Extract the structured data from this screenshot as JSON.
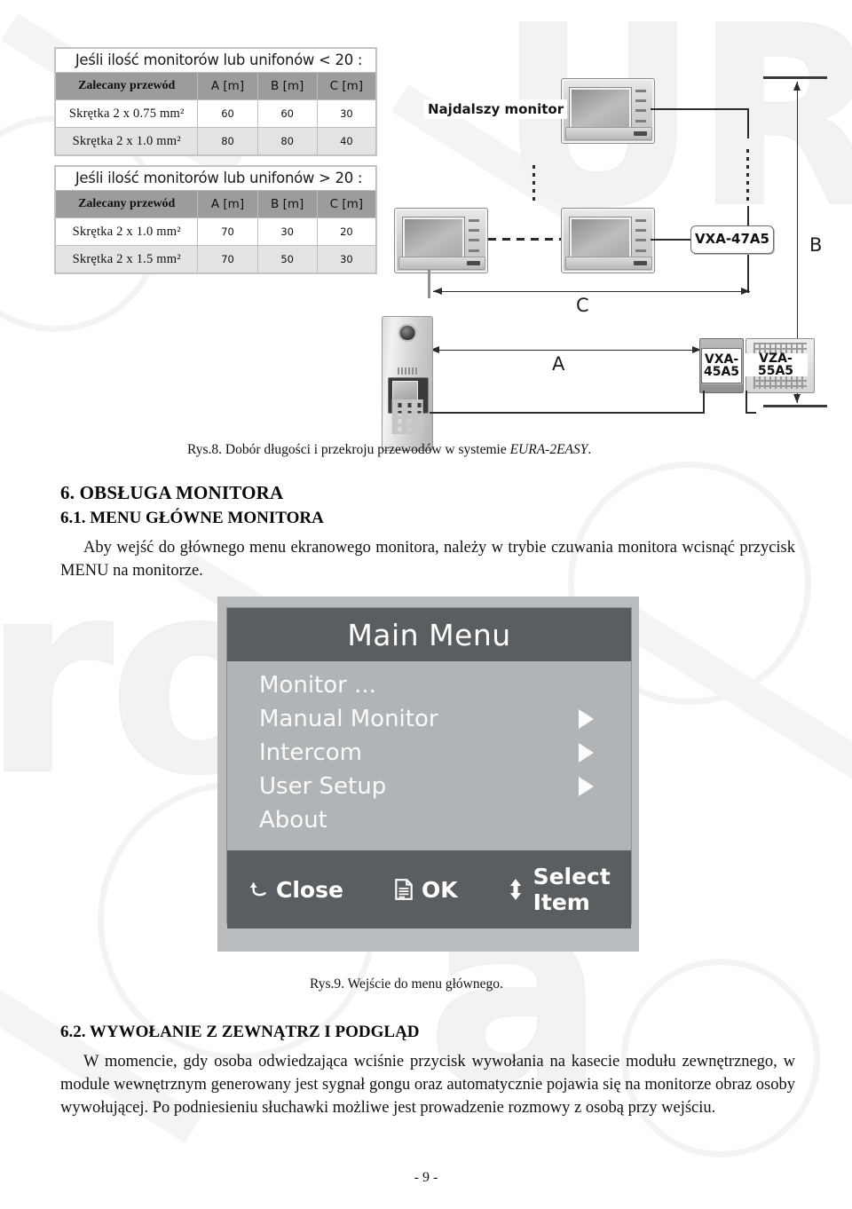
{
  "figure8": {
    "caption_prefix": "Rys.8. Dobór długości i przekroju przewodów w systemie ",
    "caption_italic": "EURA-2EASY",
    "caption_suffix": ".",
    "tables": [
      {
        "title": "Jeśli ilość monitorów lub unifonów < 20 :",
        "columns": [
          "Zalecany przewód",
          "A [m]",
          "B [m]",
          "C [m]"
        ],
        "rows": [
          [
            "Skrętka 2 x 0.75 mm²",
            "60",
            "60",
            "30"
          ],
          [
            "Skrętka 2 x 1.0 mm²",
            "80",
            "80",
            "40"
          ]
        ]
      },
      {
        "title": "Jeśli ilość monitorów lub unifonów > 20 :",
        "columns": [
          "Zalecany przewód",
          "A [m]",
          "B [m]",
          "C [m]"
        ],
        "rows": [
          [
            "Skrętka 2 x 1.0 mm²",
            "70",
            "30",
            "20"
          ],
          [
            "Skrętka 2 x 1.5 mm²",
            "70",
            "50",
            "30"
          ]
        ]
      }
    ],
    "diagram": {
      "farthest_monitor_label": "Najdalszy monitor",
      "distributor_label": "VXA-47A5",
      "splitter_label": "VXA-45A5",
      "psu_label": "VZA-55A5",
      "dim_a": "A",
      "dim_b": "B",
      "dim_c": "C"
    }
  },
  "section6": {
    "heading": "6. OBSŁUGA MONITORA",
    "sub1_heading": "6.1. MENU GŁÓWNE MONITORA",
    "sub1_text": "Aby wejść do głównego menu ekranowego monitora, należy w trybie czuwania monitora wcisnąć przycisk MENU na monitorze."
  },
  "figure9": {
    "caption": "Rys.9. Wejście do menu głównego.",
    "osd": {
      "title": "Main Menu",
      "items": [
        {
          "label": "Monitor ...",
          "has_arrow": false
        },
        {
          "label": "Manual Monitor",
          "has_arrow": true
        },
        {
          "label": "Intercom",
          "has_arrow": true
        },
        {
          "label": "User Setup",
          "has_arrow": true
        },
        {
          "label": "About",
          "has_arrow": false
        }
      ],
      "buttons": [
        {
          "label": "Close",
          "icon": "back-arrow-icon"
        },
        {
          "label": "OK",
          "icon": "document-icon"
        },
        {
          "label": "Select Item",
          "icon": "up-down-arrow-icon"
        }
      ]
    }
  },
  "section62": {
    "heading": "6.2. WYWOŁANIE Z ZEWNĄTRZ I PODGLĄD",
    "text": "W momencie, gdy osoba odwiedzająca wciśnie przycisk wywołania na kasecie modułu zewnętrznego, w module wewnętrznym generowany jest sygnał gongu oraz automatycznie pojawia się na monitorze obraz osoby wywołującej. Po podniesieniu słuchawki możliwe jest prowadzenie rozmowy z osobą przy wejściu."
  },
  "footer": {
    "page_number": "- 9 -"
  },
  "colors": {
    "table_header": "#9c9c9c",
    "osd_bar": "#5a5e60",
    "osd_body": "#b0b4b6",
    "wire": "#2b2b2b"
  }
}
